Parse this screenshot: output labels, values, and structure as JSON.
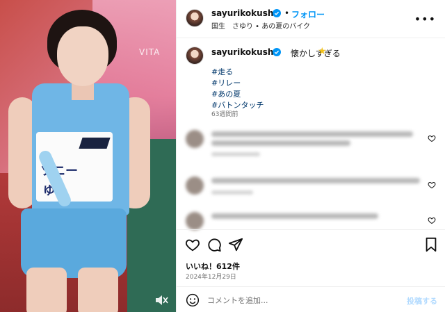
{
  "photo": {
    "watermark": "VITA",
    "bib_line1": "ソニー",
    "bib_line2": "ゆり"
  },
  "header": {
    "username": "sayurikokusho",
    "separator": "•",
    "follow_label": "フォロー",
    "subtitle": "国生　さゆり • あの夏のバイク",
    "more": "•••"
  },
  "caption": {
    "username": "sayurikokusho",
    "text": "懐かしすぎる",
    "emoji": "★",
    "hashtags": [
      "#走る",
      "#リレー",
      "#あの夏",
      "#バトンタッチ"
    ],
    "time_ago": "63週間前"
  },
  "post": {
    "likes": "いいね！612件",
    "date": "2024年12月29日"
  },
  "compose": {
    "placeholder": "コメントを追加...",
    "post_label": "投稿する"
  },
  "colors": {
    "accent": "#0095f6",
    "hashtag": "#00376b",
    "muted": "#737373"
  },
  "icons": [
    "verified-badge-icon",
    "more-icon",
    "heart-icon",
    "comment-icon",
    "share-icon",
    "bookmark-icon",
    "emoji-icon",
    "mute-icon"
  ]
}
